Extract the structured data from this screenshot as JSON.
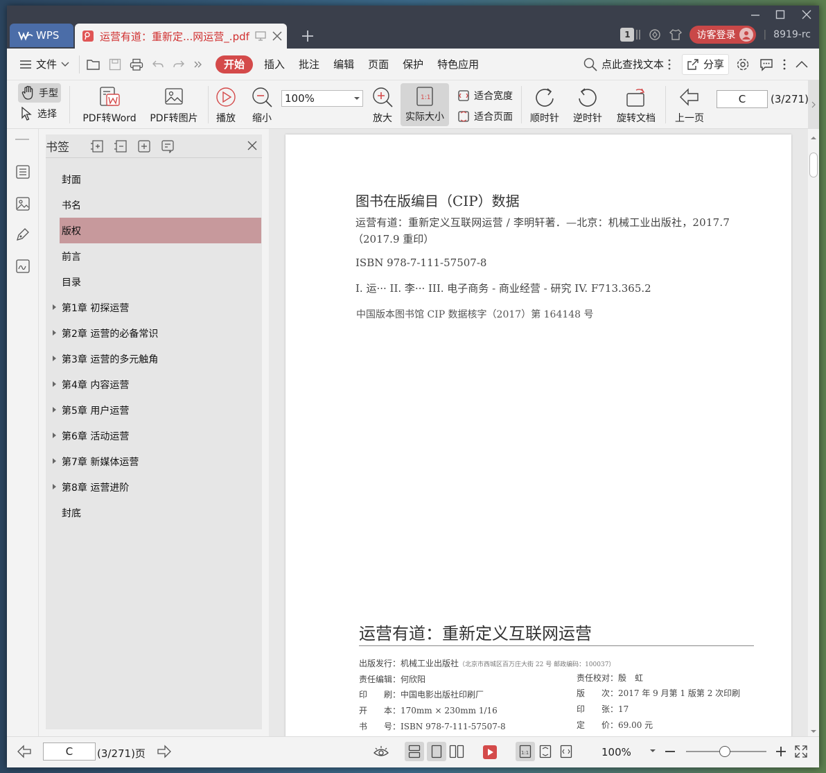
{
  "titlebar": {
    "app_tab": "WPS",
    "doc_tab": "运营有道：重新定...网运营_.pdf",
    "badge": "1",
    "login": "访客登录",
    "user": "8919-rc"
  },
  "menubar": {
    "file": "文件",
    "tabs": [
      "开始",
      "插入",
      "批注",
      "编辑",
      "页面",
      "保护",
      "特色应用"
    ],
    "search": "点此查找文本",
    "share": "分享"
  },
  "ribbon": {
    "hand": "手型",
    "select": "选择",
    "pdf_to_word": "PDF转Word",
    "pdf_to_image": "PDF转图片",
    "play": "播放",
    "zoom_out": "缩小",
    "zoom_value": "100%",
    "zoom_in": "放大",
    "actual_size": "实际大小",
    "fit_width": "适合宽度",
    "fit_page": "适合页面",
    "clockwise": "顺时针",
    "counterclockwise": "逆时针",
    "rotate_doc": "旋转文档",
    "prev_page": "上一页",
    "page_input": "C",
    "page_count": "(3/271)"
  },
  "bookmarks": {
    "title": "书签",
    "items": [
      {
        "label": "封面",
        "expandable": false,
        "active": false
      },
      {
        "label": "书名",
        "expandable": false,
        "active": false
      },
      {
        "label": "版权",
        "expandable": false,
        "active": true
      },
      {
        "label": "前言",
        "expandable": false,
        "active": false
      },
      {
        "label": "目录",
        "expandable": false,
        "active": false
      },
      {
        "label": "第1章  初探运营",
        "expandable": true,
        "active": false
      },
      {
        "label": "第2章  运营的必备常识",
        "expandable": true,
        "active": false
      },
      {
        "label": "第3章  运营的多元触角",
        "expandable": true,
        "active": false
      },
      {
        "label": "第4章  内容运营",
        "expandable": true,
        "active": false
      },
      {
        "label": "第5章  用户运营",
        "expandable": true,
        "active": false
      },
      {
        "label": "第6章  活动运营",
        "expandable": true,
        "active": false
      },
      {
        "label": "第7章  新媒体运营",
        "expandable": true,
        "active": false
      },
      {
        "label": "第8章  运营进阶",
        "expandable": true,
        "active": false
      },
      {
        "label": "封底",
        "expandable": false,
        "active": false
      }
    ]
  },
  "document": {
    "cip_heading": "图书在版编目（CIP）数据",
    "cip_line1": "运营有道：重新定义互联网运营 / 李明轩著．—北京：机械工业出版社，2017.7",
    "cip_line2": "（2017.9 重印）",
    "isbn": "ISBN 978-7-111-57507-8",
    "classification": "I. 运···   II. 李···   III. 电子商务 - 商业经营 - 研究   IV. F713.365.2",
    "cip_number": "中国版本图书馆 CIP 数据核字（2017）第 164148 号",
    "book_title": "运营有道：重新定义互联网运营",
    "publisher_label": "出版发行：",
    "publisher": "机械工业出版社",
    "publisher_address": "（北京市西城区百万庄大街 22 号   邮政编码：100037）",
    "editor_label": "责任编辑：",
    "editor": "何欣阳",
    "proofreader_label": "责任校对：",
    "proofreader": "殷　虹",
    "printer_label": "印　　刷：",
    "printer": "中国电影出版社印刷厂",
    "edition_label": "版　　次：",
    "edition": "2017 年 9 月第 1 版第 2 次印刷",
    "format_label": "开　　本：",
    "format": "170mm × 230mm   1/16",
    "sheets_label": "印　　张：",
    "sheets": "17",
    "bookno_label": "书　　号：",
    "bookno": "ISBN 978-7-111-57507-8",
    "price_label": "定　　价：",
    "price": "69.00 元"
  },
  "statusbar": {
    "page_input": "C",
    "page_count": "(3/271)页",
    "zoom": "100%"
  },
  "colors": {
    "accent": "#d44a4a",
    "tab_blue": "#4b6da8",
    "active_bookmark": "#c7999c"
  }
}
